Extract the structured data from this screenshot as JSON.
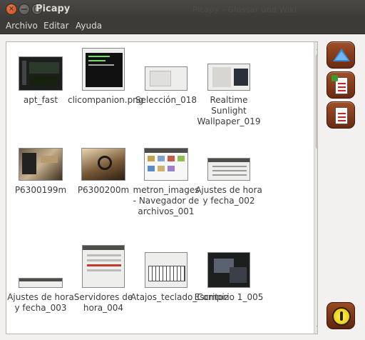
{
  "window": {
    "title": "Picapy",
    "background_title_text": "Picapy - Glossar und Wiki",
    "accent": "#8b3a16"
  },
  "menubar": {
    "items": [
      "Archivo",
      "Editar",
      "Ayuda"
    ]
  },
  "iconview": {
    "items": [
      {
        "label": "apt_fast",
        "thumb": "dark-desktop"
      },
      {
        "label": "clicompanion.png",
        "thumb": "terminal"
      },
      {
        "label": "Selección_018",
        "thumb": "dialog"
      },
      {
        "label": "Realtime Sunlight Wallpaper_019",
        "thumb": "window"
      },
      {
        "label": "P6300199m",
        "thumb": "photo"
      },
      {
        "label": "P6300200m",
        "thumb": "photo"
      },
      {
        "label": "metron_images - Navegador de archivos_001",
        "thumb": "file-browser"
      },
      {
        "label": "Ajustes de hora y fecha_002",
        "thumb": "settings"
      },
      {
        "label": "Ajustes de hora y fecha_003",
        "thumb": "settings"
      },
      {
        "label": "Servidores de hora_004",
        "thumb": "dialog-list"
      },
      {
        "label": "Atajos_teclado_Compiz",
        "thumb": "keyboard"
      },
      {
        "label": "Escritorio 1_005",
        "thumb": "dark-desktop"
      }
    ]
  },
  "sidebuttons": {
    "upload": "upload-icon",
    "add": "add-document-icon",
    "remove": "remove-document-icon",
    "quit": "power-icon"
  }
}
